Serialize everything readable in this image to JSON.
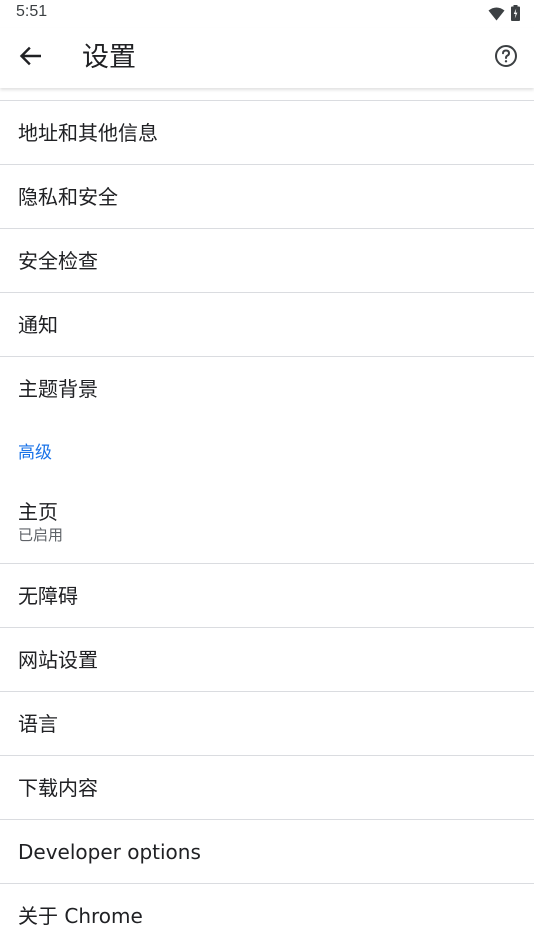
{
  "status_bar": {
    "time": "5:51",
    "icons": [
      "wifi-icon",
      "battery-icon"
    ]
  },
  "app_bar": {
    "title": "设置",
    "back_icon": "arrow-back-icon",
    "help_icon": "help-circle-icon"
  },
  "items": [
    {
      "label": "地址和其他信息"
    },
    {
      "label": "隐私和安全"
    },
    {
      "label": "安全检查"
    },
    {
      "label": "通知"
    },
    {
      "label": "主题背景"
    }
  ],
  "advanced_section": {
    "header": "高级",
    "items": [
      {
        "label": "主页",
        "sub": "已启用"
      },
      {
        "label": "无障碍"
      },
      {
        "label": "网站设置"
      },
      {
        "label": "语言"
      },
      {
        "label": "下载内容"
      },
      {
        "label": "Developer options"
      },
      {
        "label": "关于 Chrome"
      }
    ]
  },
  "colors": {
    "accent": "#1a73e8",
    "divider": "#dadce0",
    "text_primary": "#202124",
    "text_secondary": "#5f6368"
  }
}
